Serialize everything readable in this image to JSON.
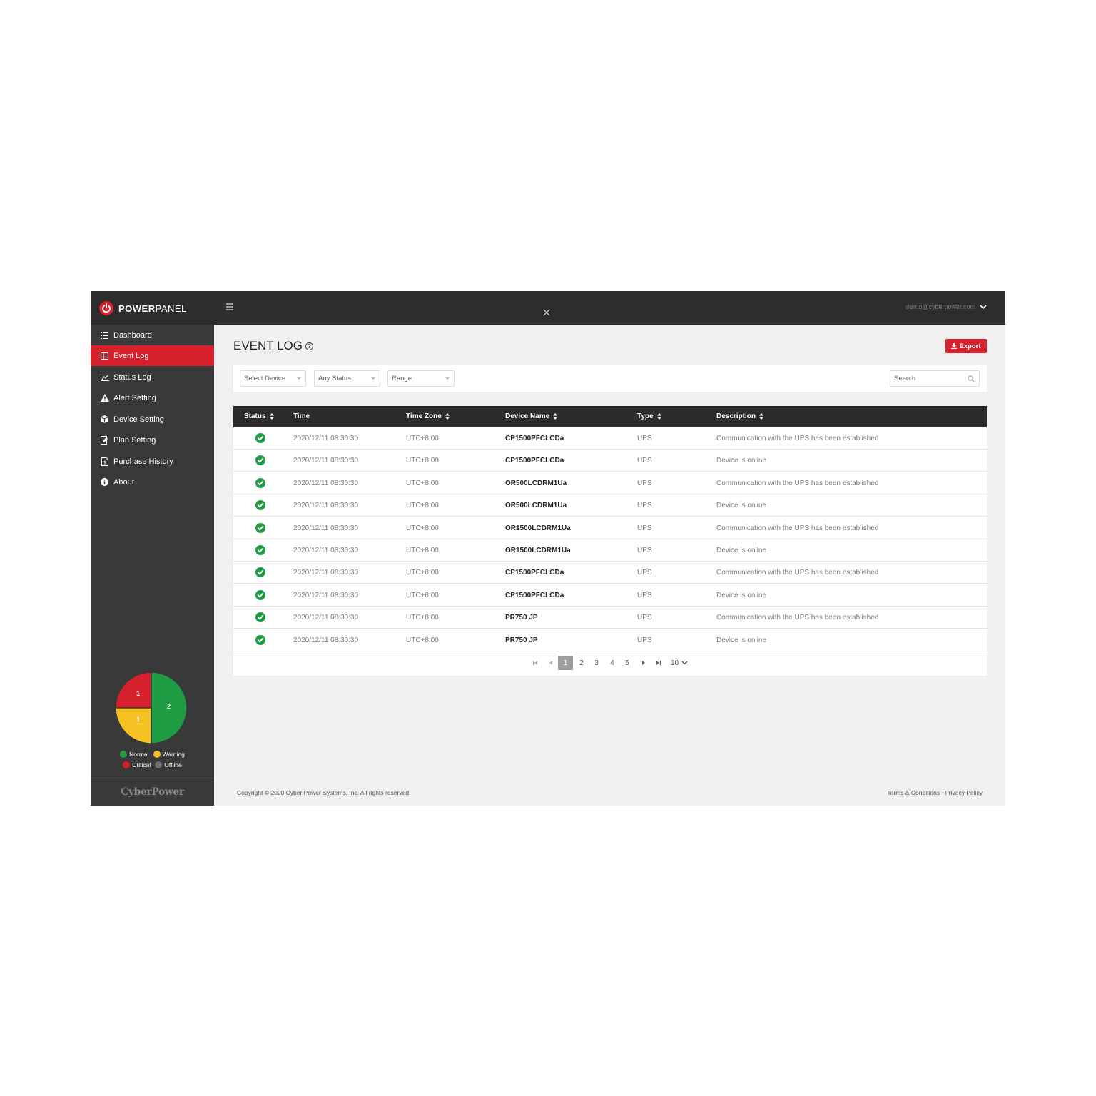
{
  "app": {
    "logo_bold": "POWER",
    "logo_light": "PANEL",
    "user_email": "demo@cyberpower.com"
  },
  "sidebar": {
    "items": [
      {
        "label": "Dashboard",
        "icon": "list-icon"
      },
      {
        "label": "Event Log",
        "icon": "table-icon",
        "active": true
      },
      {
        "label": "Status Log",
        "icon": "line-chart-icon"
      },
      {
        "label": "Alert Setting",
        "icon": "warning-icon"
      },
      {
        "label": "Device Setting",
        "icon": "cube-icon"
      },
      {
        "label": "Plan Setting",
        "icon": "edit-document-icon"
      },
      {
        "label": "Purchase History",
        "icon": "receipt-icon"
      },
      {
        "label": "About",
        "icon": "info-icon"
      }
    ],
    "status_pie": {
      "critical": "1",
      "warning": "1",
      "normal": "2"
    },
    "legend": {
      "normal": "Normal",
      "warning": "Warning",
      "critical": "Critical",
      "offline": "Offline"
    },
    "brand": "CyberPower"
  },
  "colors": {
    "accent": "#d6202c",
    "normal": "#1f9c43",
    "warning": "#f6c223",
    "critical": "#d6202c",
    "offline": "#6e6e6e"
  },
  "page": {
    "title": "EVENT LOG",
    "export_label": "Export"
  },
  "filters": {
    "device": "Select Device",
    "status": "Any Status",
    "range": "Range",
    "search_placeholder": "Search"
  },
  "table": {
    "headers": {
      "status": "Status",
      "time": "Time",
      "timezone": "Time Zone",
      "device": "Device Name",
      "type": "Type",
      "description": "Description"
    },
    "rows": [
      {
        "status": "normal",
        "time": "2020/12/11 08:30:30",
        "timezone": "UTC+8:00",
        "device": "CP1500PFCLCDa",
        "type": "UPS",
        "description": "Communication with the UPS has been established"
      },
      {
        "status": "normal",
        "time": "2020/12/11 08:30:30",
        "timezone": "UTC+8:00",
        "device": "CP1500PFCLCDa",
        "type": "UPS",
        "description": "Device is online"
      },
      {
        "status": "normal",
        "time": "2020/12/11 08:30:30",
        "timezone": "UTC+8:00",
        "device": "OR500LCDRM1Ua",
        "type": "UPS",
        "description": "Communication with the UPS has been established"
      },
      {
        "status": "normal",
        "time": "2020/12/11 08:30:30",
        "timezone": "UTC+8:00",
        "device": "OR500LCDRM1Ua",
        "type": "UPS",
        "description": "Device is online"
      },
      {
        "status": "normal",
        "time": "2020/12/11 08:30:30",
        "timezone": "UTC+8:00",
        "device": "OR1500LCDRM1Ua",
        "type": "UPS",
        "description": "Communication with the UPS has been established"
      },
      {
        "status": "normal",
        "time": "2020/12/11 08:30:30",
        "timezone": "UTC+8:00",
        "device": "OR1500LCDRM1Ua",
        "type": "UPS",
        "description": "Device is online"
      },
      {
        "status": "normal",
        "time": "2020/12/11 08:30:30",
        "timezone": "UTC+8:00",
        "device": "CP1500PFCLCDa",
        "type": "UPS",
        "description": "Communication with the UPS has been established"
      },
      {
        "status": "normal",
        "time": "2020/12/11 08:30:30",
        "timezone": "UTC+8:00",
        "device": "CP1500PFCLCDa",
        "type": "UPS",
        "description": "Device is online"
      },
      {
        "status": "normal",
        "time": "2020/12/11 08:30:30",
        "timezone": "UTC+8:00",
        "device": "PR750 JP",
        "type": "UPS",
        "description": "Communication with the UPS has been established"
      },
      {
        "status": "normal",
        "time": "2020/12/11 08:30:30",
        "timezone": "UTC+8:00",
        "device": "PR750 JP",
        "type": "UPS",
        "description": "Device is online"
      }
    ]
  },
  "pagination": {
    "pages": [
      "1",
      "2",
      "3",
      "4",
      "5"
    ],
    "current": "1",
    "page_size": "10"
  },
  "footer": {
    "copyright": "Copyright © 2020 Cyber Power Systems, Inc. All rights reserved.",
    "terms": "Terms & Conditions",
    "privacy": "Privacy Policy"
  }
}
